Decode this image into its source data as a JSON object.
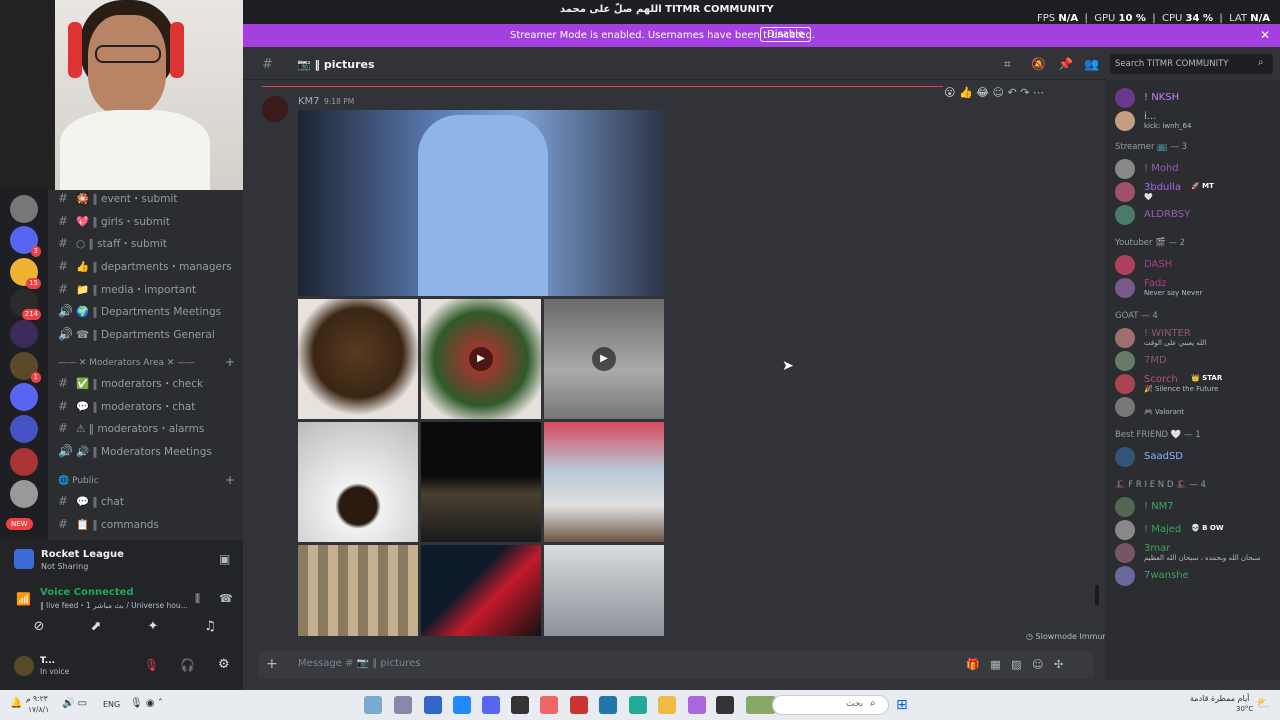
{
  "topbar": {
    "title": "TITMR COMMUNITY",
    "title_overlay": "اللهم صلّ على محمد",
    "fps_label": "FPS",
    "fps": "N/A",
    "gpu_label": "GPU",
    "gpu": "10 %",
    "cpu_label": "CPU",
    "cpu": "34 %",
    "lat_label": "LAT",
    "lat": "N/A"
  },
  "streamer_bar": {
    "message": "Streamer Mode is enabled. Usernames have been truncated.",
    "button": "Disable"
  },
  "servers": [
    {
      "badge": "3"
    },
    {
      "badge": "15"
    },
    {
      "badge": "214"
    },
    {
      "badge": ""
    },
    {
      "badge": "1"
    },
    {
      "badge": ""
    },
    {
      "badge": ""
    },
    {
      "badge": ""
    },
    {
      "badge": ""
    },
    {
      "badge": "NEW"
    }
  ],
  "channels": [
    {
      "icon": "#",
      "label": "🎇 ‖ event・submit"
    },
    {
      "icon": "#",
      "label": "💖 ‖ girls・submit"
    },
    {
      "icon": "#",
      "label": "○ ‖ staff・submit"
    },
    {
      "icon": "#",
      "label": "👍 ‖ departments・managers"
    },
    {
      "icon": "#",
      "label": "📁 ‖ media・important"
    },
    {
      "icon": "🔊",
      "label": "🌍 ‖ Departments Meetings"
    },
    {
      "icon": "🔊",
      "label": "☎ ‖ Departments General"
    }
  ],
  "mod_category": "—— ✕ Moderators Area ✕ ——",
  "mod_channels": [
    {
      "icon": "#",
      "label": "✅ ‖ moderators・check"
    },
    {
      "icon": "#",
      "label": "💬 ‖ moderators・chat"
    },
    {
      "icon": "#",
      "label": "⚠ ‖ moderators・alarms"
    },
    {
      "icon": "🔊",
      "label": "🔊 ‖ Moderators Meetings"
    }
  ],
  "public_category": "Public",
  "public_channels": [
    {
      "icon": "#",
      "label": "💬 ‖ chat"
    },
    {
      "icon": "#",
      "label": "📋 ‖ commands"
    }
  ],
  "activity": {
    "game": "Rocket League",
    "game_status": "Not Sharing",
    "voice_title": "Voice Connected",
    "voice_sub": "‖ live feed・1 بث مباشر / Universe hou...",
    "user_name": "T...",
    "user_status": "In voice"
  },
  "chat": {
    "channel_name": "‖ pictures",
    "author": "KM7",
    "time": "9:18 PM",
    "slowmode": "Slowmode Immune",
    "composer_placeholder": "Message # 📷 ‖ pictures"
  },
  "search": {
    "placeholder": "Search TITMR COMMUNITY"
  },
  "members": {
    "top": [
      {
        "name": "! NKSH",
        "color": "#c77dff",
        "status": ""
      },
      {
        "name": "i...",
        "color": "#b5bac1",
        "status": "kick: iwnh_64"
      }
    ],
    "groups": [
      {
        "label": "Streamer 📺 — 3",
        "items": [
          {
            "name": "! Mohd",
            "color": "#9b59b6",
            "status": ""
          },
          {
            "name": "3bdulla",
            "color": "#a36ae0",
            "status": "🤍",
            "tag": "🚀 MT"
          },
          {
            "name": "ALDRBSY",
            "color": "#9b59b6",
            "status": ""
          }
        ]
      },
      {
        "label": "Youtuber 🎬 — 2",
        "items": [
          {
            "name": "DASH",
            "color": "#b03a8c",
            "status": ""
          },
          {
            "name": "Fadz",
            "color": "#b03a8c",
            "status": "Never say Never"
          }
        ]
      },
      {
        "label": "GOAT — 4",
        "items": [
          {
            "name": "! WINTER",
            "color": "#8b5a6b",
            "status": "الله يعيني على الوقت"
          },
          {
            "name": "7MD",
            "color": "#8b5a6b",
            "status": ""
          },
          {
            "name": "Scorch",
            "color": "#c0506a",
            "status": "🎉 Silence the Future",
            "tag": "👑 STAR"
          },
          {
            "name": "",
            "color": "#b5bac1",
            "status": "🎮 Valorant"
          }
        ]
      },
      {
        "label": "Best FRIEND 🤍 — 1",
        "items": [
          {
            "name": "SaadSD",
            "color": "#7fb3ff",
            "status": ""
          }
        ]
      },
      {
        "label": "🎩 F R I E N D 🎩 — 4",
        "items": [
          {
            "name": "! NM7",
            "color": "#3ba55d",
            "status": ""
          },
          {
            "name": "! Majed",
            "color": "#3ba55d",
            "status": "",
            "tag": "💀 B OW"
          },
          {
            "name": "3mar",
            "color": "#3ba55d",
            "status": "سبحان الله وبحمده ، سبحان الله العظيم"
          },
          {
            "name": "7wanshe",
            "color": "#3ba55d",
            "status": ""
          }
        ]
      }
    ]
  },
  "taskbar": {
    "lang": "ENG",
    "search_placeholder": "بحث",
    "time": "٩:٢٣ م",
    "date": "١٧/٨/١",
    "weather": "أيام ممطرة قادمة",
    "temp": "30°C"
  },
  "colors": {
    "accent": "#a43fe0",
    "online": "#23a55a",
    "bg": "#313338",
    "sidebar": "#2b2d31",
    "dark": "#1e1f22"
  }
}
